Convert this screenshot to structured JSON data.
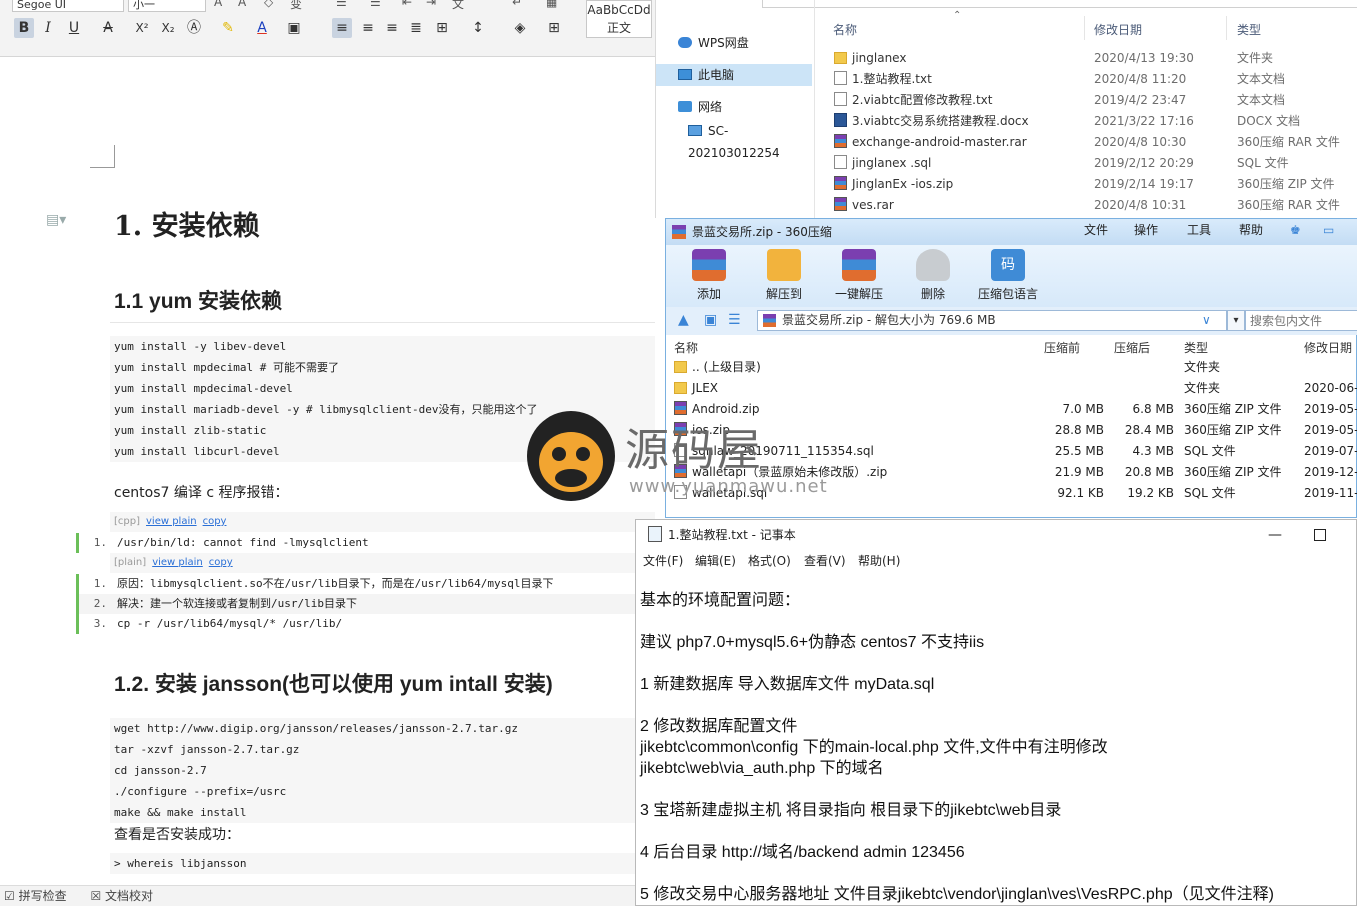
{
  "word": {
    "ribbon": {
      "font_name": "Segoe UI",
      "font_size": "小一",
      "style_preview": "AaBbCcDd",
      "style_name": "正文",
      "bold": "B",
      "italic": "I",
      "underline": "U",
      "strike": "A",
      "superscript": "X²",
      "subscript": "X₂"
    },
    "h1": "1.  安装依赖",
    "h2a": "1.1 yum 安装依赖",
    "code1": [
      "yum install -y libev-devel",
      "yum install mpdecimal # 可能不需要了",
      "yum install mpdecimal-devel",
      "yum install mariadb-devel -y # libmysqlclient-dev没有，只能用这个了",
      "yum install zlib-static",
      "yum install libcurl-devel"
    ],
    "para1": "centos7 编译 c 程序报错：",
    "bar1": {
      "tag": "[cpp]",
      "view": "view plain",
      "copy": "copy"
    },
    "list1": [
      {
        "n": "1.",
        "t": "/usr/bin/ld: cannot find -lmysqlclient"
      }
    ],
    "bar2": {
      "tag": "[plain]",
      "view": "view plain",
      "copy": "copy"
    },
    "list2": [
      {
        "n": "1.",
        "t": "原因：libmysqlclient.so不在/usr/lib目录下，而是在/usr/lib64/mysql目录下"
      },
      {
        "n": "2.",
        "t": "解决：建一个软连接或者复制到/usr/lib目录下"
      },
      {
        "n": "3.",
        "t": "cp -r /usr/lib64/mysql/* /usr/lib/"
      }
    ],
    "h2b": "1.2.  安装  jansson(也可以使用 yum intall 安装)",
    "code2": [
      "wget http://www.digip.org/jansson/releases/jansson-2.7.tar.gz",
      "tar -xzvf jansson-2.7.tar.gz",
      "cd  jansson-2.7",
      "./configure --prefix=/usrc",
      "make && make install"
    ],
    "para2": "查看是否安装成功：",
    "code3": [
      "> whereis libjansson"
    ],
    "status": {
      "spell": "拼写检查",
      "proof": "文档校对"
    }
  },
  "explorer": {
    "nav": [
      {
        "label": "WPS网盘",
        "icon": "cloud-icon"
      },
      {
        "label": "此电脑",
        "icon": "computer-icon"
      },
      {
        "label": "网络",
        "icon": "network-icon"
      },
      {
        "label": "SC-202103012254",
        "icon": "computer-icon"
      }
    ],
    "columns": {
      "name": "名称",
      "date": "修改日期",
      "type": "类型"
    },
    "files": [
      {
        "name": "jinglanex",
        "date": "2020/4/13 19:30",
        "type": "文件夹",
        "icon": "folder"
      },
      {
        "name": "1.整站教程.txt",
        "date": "2020/4/8 11:20",
        "type": "文本文档",
        "icon": "txt"
      },
      {
        "name": "2.viabtc配置修改教程.txt",
        "date": "2019/4/2 23:47",
        "type": "文本文档",
        "icon": "txt"
      },
      {
        "name": "3.viabtc交易系统搭建教程.docx",
        "date": "2021/3/22 17:16",
        "type": "DOCX 文档",
        "icon": "doc"
      },
      {
        "name": "exchange-android-master.rar",
        "date": "2020/4/8 10:30",
        "type": "360压缩 RAR 文件",
        "icon": "rar"
      },
      {
        "name": "jinglanex .sql",
        "date": "2019/2/12 20:29",
        "type": "SQL 文件",
        "icon": "txt"
      },
      {
        "name": "JinglanEx -ios.zip",
        "date": "2019/2/14 19:17",
        "type": "360压缩 ZIP 文件",
        "icon": "rar"
      },
      {
        "name": "ves.rar",
        "date": "2020/4/8 10:31",
        "type": "360压缩 RAR 文件",
        "icon": "rar"
      }
    ]
  },
  "zip": {
    "title": "景蓝交易所.zip - 360压缩",
    "menu": [
      "文件",
      "操作",
      "工具",
      "帮助"
    ],
    "tools": [
      "添加",
      "解压到",
      "一键解压",
      "删除",
      "压缩包语言"
    ],
    "path": "景蓝交易所.zip - 解包大小为 769.6 MB",
    "search_placeholder": "搜索包内文件",
    "columns": {
      "name": "名称",
      "before": "压缩前",
      "after": "压缩后",
      "type": "类型",
      "date": "修改日期"
    },
    "rows": [
      {
        "name": ".. (上级目录)",
        "before": "",
        "after": "",
        "type": "文件夹",
        "date": "",
        "icon": "folder"
      },
      {
        "name": "JLEX",
        "before": "",
        "after": "",
        "type": "文件夹",
        "date": "2020-06-",
        "icon": "folder"
      },
      {
        "name": "Android.zip",
        "before": "7.0 MB",
        "after": "6.8 MB",
        "type": "360压缩 ZIP 文件",
        "date": "2019-05-",
        "icon": "rar"
      },
      {
        "name": "ios.zip",
        "before": "28.8 MB",
        "after": "28.4 MB",
        "type": "360压缩 ZIP 文件",
        "date": "2019-05-",
        "icon": "rar"
      },
      {
        "name": "sqnlaw_20190711_115354.sql",
        "before": "25.5 MB",
        "after": "4.3 MB",
        "type": "SQL 文件",
        "date": "2019-07-",
        "icon": "txt"
      },
      {
        "name": "walletapi（景蓝原始未修改版）.zip",
        "before": "21.9 MB",
        "after": "20.8 MB",
        "type": "360压缩 ZIP 文件",
        "date": "2019-12-",
        "icon": "rar"
      },
      {
        "name": "walletapi.sql",
        "before": "92.1 KB",
        "after": "19.2 KB",
        "type": "SQL 文件",
        "date": "2019-11-",
        "icon": "txt"
      }
    ]
  },
  "notepad": {
    "title": "1.整站教程.txt - 记事本",
    "menu": [
      "文件(F)",
      "编辑(E)",
      "格式(O)",
      "查看(V)",
      "帮助(H)"
    ],
    "lines": [
      "基本的环境配置问题：",
      "",
      "建议 php7.0+mysql5.6+伪静态 centos7  不支持iis",
      "",
      "1 新建数据库  导入数据库文件  myData.sql",
      "",
      "2 修改数据库配置文件",
      "jikebtc\\common\\config 下的main-local.php 文件,文件中有注明修改",
      "jikebtc\\web\\via_auth.php 下的域名",
      "",
      "3 宝塔新建虚拟主机 将目录指向 根目录下的jikebtc\\web目录",
      "",
      "4 后台目录 http://域名/backend   admin   123456",
      "",
      "5  修改交易中心服务器地址 文件目录jikebtc\\vendor\\jinglan\\ves\\VesRPC.php（见文件注释)"
    ]
  },
  "watermark": {
    "brand": "源码屋",
    "url": "www.yuanmawu.net"
  },
  "colors": {
    "accent_green": "#6bbf59",
    "link_blue": "#2a6fd6",
    "zip_title": "#c3dcf4",
    "folder": "#f2c94c"
  }
}
